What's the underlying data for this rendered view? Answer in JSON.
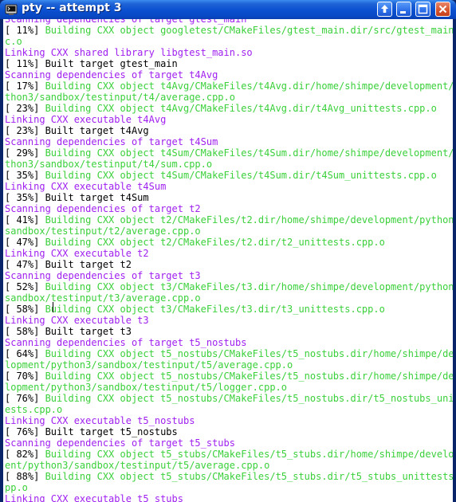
{
  "window": {
    "title": "pty -- attempt 3",
    "icon": "terminal-app-icon",
    "buttons": [
      {
        "name": "up-arrow-button",
        "icon": "up-arrow-icon"
      },
      {
        "name": "minimize-button",
        "icon": "minimize-icon"
      },
      {
        "name": "maximize-button",
        "icon": "maximize-icon"
      },
      {
        "name": "close-button",
        "icon": "close-icon"
      }
    ]
  },
  "colors": {
    "default": "#000000",
    "green": "#3ad03a",
    "magenta": "#a020f0",
    "titlebar": "#0a50d0"
  },
  "terminal": {
    "lines": [
      {
        "text": "Scanning dependencies of target gtest_main",
        "color": "magenta"
      },
      {
        "text": "[ 11%] ",
        "color": "default",
        "rest": "Building CXX object googletest/CMakeFiles/gtest_main.dir/src/gtest_main.c"
      },
      {
        "text": "c.o",
        "color": "green"
      },
      {
        "text": "Linking CXX shared library libgtest_main.so",
        "color": "magenta"
      },
      {
        "text": "[ 11%] Built target gtest_main",
        "color": "default"
      },
      {
        "text": "Scanning dependencies of target t4Avg",
        "color": "magenta"
      },
      {
        "text": "[ 17%] ",
        "color": "default",
        "rest": "Building CXX object t4Avg/CMakeFiles/t4Avg.dir/home/shimpe/development/py"
      },
      {
        "text": "thon3/sandbox/testinput/t4/average.cpp.o",
        "color": "green"
      },
      {
        "text": "[ 23%] ",
        "color": "default",
        "rest": "Building CXX object t4Avg/CMakeFiles/t4Avg.dir/t4Avg_unittests.cpp.o"
      },
      {
        "text": "Linking CXX executable t4Avg",
        "color": "magenta"
      },
      {
        "text": "[ 23%] Built target t4Avg",
        "color": "default"
      },
      {
        "text": "Scanning dependencies of target t4Sum",
        "color": "magenta"
      },
      {
        "text": "[ 29%] ",
        "color": "default",
        "rest": "Building CXX object t4Sum/CMakeFiles/t4Sum.dir/home/shimpe/development/py"
      },
      {
        "text": "thon3/sandbox/testinput/t4/sum.cpp.o",
        "color": "green"
      },
      {
        "text": "[ 35%] ",
        "color": "default",
        "rest": "Building CXX object t4Sum/CMakeFiles/t4Sum.dir/t4Sum_unittests.cpp.o"
      },
      {
        "text": "Linking CXX executable t4Sum",
        "color": "magenta"
      },
      {
        "text": "[ 35%] Built target t4Sum",
        "color": "default"
      },
      {
        "text": "Scanning dependencies of target t2",
        "color": "magenta"
      },
      {
        "text": "[ 41%] ",
        "color": "default",
        "rest": "Building CXX object t2/CMakeFiles/t2.dir/home/shimpe/development/python3/"
      },
      {
        "text": "sandbox/testinput/t2/average.cpp.o",
        "color": "green"
      },
      {
        "text": "[ 47%] ",
        "color": "default",
        "rest": "Building CXX object t2/CMakeFiles/t2.dir/t2_unittests.cpp.o"
      },
      {
        "text": "Linking CXX executable t2",
        "color": "magenta"
      },
      {
        "text": "[ 47%] Built target t2",
        "color": "default"
      },
      {
        "text": "Scanning dependencies of target t3",
        "color": "magenta"
      },
      {
        "text": "[ 52%] ",
        "color": "default",
        "rest": "Building CXX object t3/CMakeFiles/t3.dir/home/shimpe/development/python3/"
      },
      {
        "text": "sandbox/testinput/t3/average.cpp.o",
        "color": "green"
      },
      {
        "text": "[ 58%] ",
        "color": "default",
        "rest": "Building CXX object t3/CMakeFiles/t3.dir/t3_unittests.cpp.o"
      },
      {
        "text": "Linking CXX executable t3",
        "color": "magenta"
      },
      {
        "text": "[ 58%] Built target t3",
        "color": "default"
      },
      {
        "text": "Scanning dependencies of target t5_nostubs",
        "color": "magenta"
      },
      {
        "text": "[ 64%] ",
        "color": "default",
        "rest": "Building CXX object t5_nostubs/CMakeFiles/t5_nostubs.dir/home/shimpe/deve"
      },
      {
        "text": "lopment/python3/sandbox/testinput/t5/average.cpp.o",
        "color": "green"
      },
      {
        "text": "[ 70%] ",
        "color": "default",
        "rest": "Building CXX object t5_nostubs/CMakeFiles/t5_nostubs.dir/home/shimpe/deve"
      },
      {
        "text": "lopment/python3/sandbox/testinput/t5/logger.cpp.o",
        "color": "green"
      },
      {
        "text": "[ 76%] ",
        "color": "default",
        "rest": "Building CXX object t5_nostubs/CMakeFiles/t5_nostubs.dir/t5_nostubs_unitt"
      },
      {
        "text": "ests.cpp.o",
        "color": "green"
      },
      {
        "text": "Linking CXX executable t5_nostubs",
        "color": "magenta"
      },
      {
        "text": "[ 76%] Built target t5_nostubs",
        "color": "default"
      },
      {
        "text": "Scanning dependencies of target t5_stubs",
        "color": "magenta"
      },
      {
        "text": "[ 82%] ",
        "color": "default",
        "rest": "Building CXX object t5_stubs/CMakeFiles/t5_stubs.dir/home/shimpe/developm"
      },
      {
        "text": "ent/python3/sandbox/testinput/t5/average.cpp.o",
        "color": "green"
      },
      {
        "text": "[ 88%] ",
        "color": "default",
        "rest": "Building CXX object t5_stubs/CMakeFiles/t5_stubs.dir/t5_stubs_unittests.c"
      },
      {
        "text": "pp.o",
        "color": "green"
      },
      {
        "text": "Linking CXX executable t5_stubs",
        "color": "magenta"
      }
    ]
  }
}
